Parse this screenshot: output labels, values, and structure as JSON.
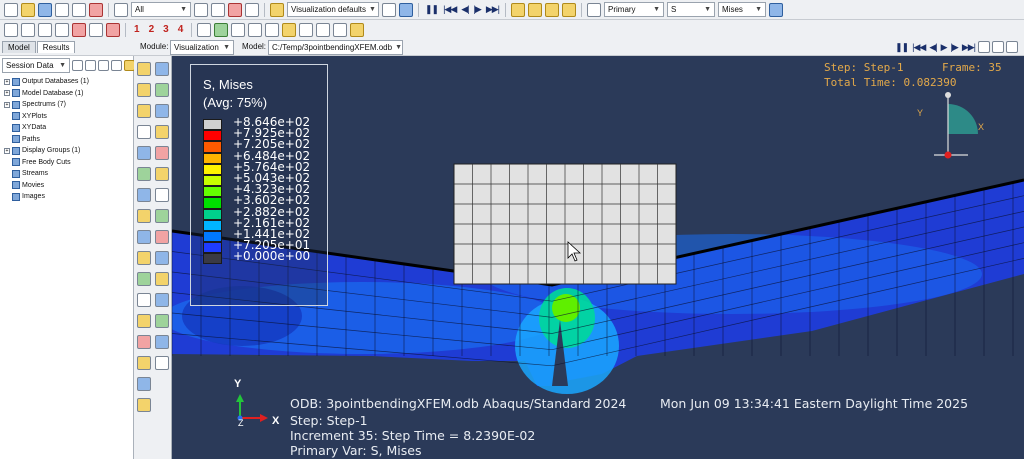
{
  "toolbar1": {
    "filter_value": "All",
    "defaults_value": "Visualization defaults",
    "var_position": "Primary",
    "var_name": "S",
    "var_invariant": "Mises"
  },
  "toolbar2": {
    "numbers": [
      "1",
      "2",
      "3",
      "4"
    ]
  },
  "tabs": [
    "Model",
    "Results"
  ],
  "module": {
    "label": "Module:",
    "value": "Visualization"
  },
  "model_path": {
    "label": "Model:",
    "value": "C:/Temp/3pointbendingXFEM.odb"
  },
  "session": {
    "value": "Session Data"
  },
  "tree": [
    {
      "label": "Output Databases (1)",
      "expand": "+"
    },
    {
      "label": "Model Database (1)",
      "expand": "+"
    },
    {
      "label": "Spectrums (7)",
      "expand": "+"
    },
    {
      "label": "XYPlots",
      "expand": ""
    },
    {
      "label": "XYData",
      "expand": ""
    },
    {
      "label": "Paths",
      "expand": ""
    },
    {
      "label": "Display Groups (1)",
      "expand": "+"
    },
    {
      "label": "Free Body Cuts",
      "expand": ""
    },
    {
      "label": "Streams",
      "expand": ""
    },
    {
      "label": "Movies",
      "expand": ""
    },
    {
      "label": "Images",
      "expand": ""
    }
  ],
  "legend": {
    "title": "S, Mises",
    "subtitle": "(Avg: 75%)",
    "values": [
      "+8.646e+02",
      "+7.925e+02",
      "+7.205e+02",
      "+6.484e+02",
      "+5.764e+02",
      "+5.043e+02",
      "+4.323e+02",
      "+3.602e+02",
      "+2.882e+02",
      "+2.161e+02",
      "+1.441e+02",
      "+7.205e+01",
      "+0.000e+00"
    ],
    "colors": [
      "#cfcfcf",
      "#ff0000",
      "#ff5a00",
      "#ffb400",
      "#fff200",
      "#c8ff00",
      "#64ff00",
      "#00e000",
      "#00d08c",
      "#00b4ff",
      "#0078ff",
      "#1e3cff",
      "#3a3a44"
    ]
  },
  "step_info": {
    "step": "Step: Step-1",
    "frame": "Frame: 35",
    "total_time": "Total Time: 0.082390"
  },
  "triad_small": {
    "y": "Y",
    "x": "X"
  },
  "triad": {
    "y": "Y",
    "z": "Z",
    "x": "X"
  },
  "status": {
    "odb": "ODB: 3pointbendingXFEM.odb",
    "solver": "Abaqus/Standard 2024",
    "date": "Mon Jun 09 13:34:41 Eastern Daylight Time 2025",
    "step": "Step: Step-1",
    "increment": "Increment     35: Step Time =    8.2390E-02",
    "primary": "Primary Var: S, Mises"
  }
}
